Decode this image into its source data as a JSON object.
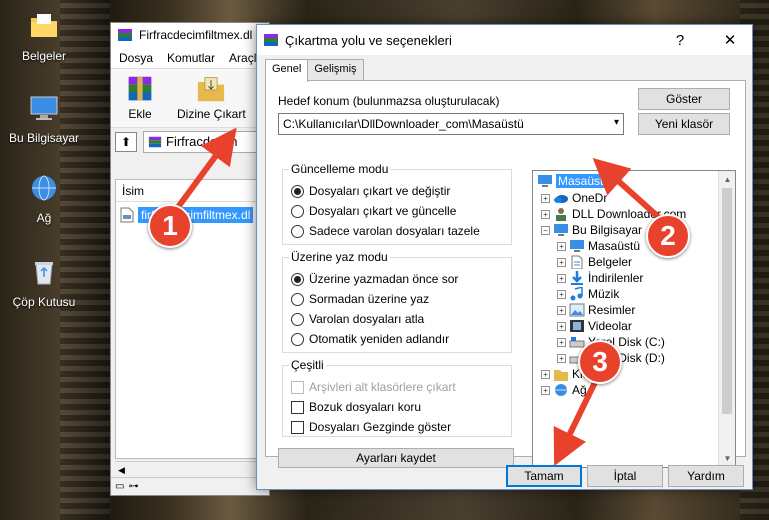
{
  "desktop": {
    "icons": [
      {
        "label": "Belgeler",
        "icon": "folder-icon"
      },
      {
        "label": "Bu Bilgisayar",
        "icon": "computer-icon"
      },
      {
        "label": "Ağ",
        "icon": "network-icon"
      },
      {
        "label": "Çöp Kutusu",
        "icon": "recycle-bin-icon"
      }
    ]
  },
  "winrar": {
    "title": "Firfracdecimfiltmex.dl",
    "menu": [
      "Dosya",
      "Komutlar",
      "Araçla"
    ],
    "toolbar": {
      "add_label": "Ekle",
      "extract_label": "Dizine Çıkart"
    },
    "path_text": "Firfracdecim",
    "column_name": "İsim",
    "file_name": "firfracdecimfiltmex.dl"
  },
  "dialog": {
    "title": "Çıkartma yolu ve seçenekleri",
    "help_btn": "?",
    "close_btn": "✕",
    "tabs": [
      "Genel",
      "Gelişmiş"
    ],
    "dest_label": "Hedef konum (bulunmazsa oluşturulacak)",
    "dest_value": "C:\\Kullanıcılar\\DllDownloader_com\\Masaüstü",
    "show_btn": "Göster",
    "new_folder_btn": "Yeni klasör",
    "update_mode": {
      "title": "Güncelleme modu",
      "options": [
        "Dosyaları çıkart ve değiştir",
        "Dosyaları çıkart ve güncelle",
        "Sadece varolan dosyaları tazele"
      ],
      "selected": 0
    },
    "overwrite_mode": {
      "title": "Üzerine yaz modu",
      "options": [
        "Üzerine yazmadan önce sor",
        "Sormadan üzerine yaz",
        "Varolan dosyaları atla",
        "Otomatik yeniden adlandır"
      ],
      "selected": 0
    },
    "misc": {
      "title": "Çeşitli",
      "options": [
        {
          "label": "Arşivleri alt klasörlere çıkart",
          "checked": false,
          "disabled": true
        },
        {
          "label": "Bozuk dosyaları koru",
          "checked": false,
          "disabled": false
        },
        {
          "label": "Dosyaları Gezginde göster",
          "checked": false,
          "disabled": false
        }
      ]
    },
    "save_settings_btn": "Ayarları kaydet",
    "tree": [
      {
        "label": "Masaüstü",
        "level": 0,
        "icon": "desktop-icon",
        "selected": true
      },
      {
        "label": "OneDr",
        "level": 1,
        "icon": "onedrive-icon"
      },
      {
        "label": "DLL Downloader.com",
        "level": 1,
        "icon": "user-icon"
      },
      {
        "label": "Bu Bilgisayar",
        "level": 1,
        "icon": "computer-icon",
        "expanded": true
      },
      {
        "label": "Masaüstü",
        "level": 2,
        "icon": "desktop-icon"
      },
      {
        "label": "Belgeler",
        "level": 2,
        "icon": "documents-icon"
      },
      {
        "label": "İndirilenler",
        "level": 2,
        "icon": "downloads-icon"
      },
      {
        "label": "Müzik",
        "level": 2,
        "icon": "music-icon"
      },
      {
        "label": "Resimler",
        "level": 2,
        "icon": "pictures-icon"
      },
      {
        "label": "Videolar",
        "level": 2,
        "icon": "videos-icon"
      },
      {
        "label": "Yerel Disk (C:)",
        "level": 2,
        "icon": "drive-icon"
      },
      {
        "label": "Yerel Disk (D:)",
        "level": 2,
        "icon": "drive-icon"
      },
      {
        "label": "Kita",
        "level": 1,
        "icon": "library-icon"
      },
      {
        "label": "Ağ",
        "level": 1,
        "icon": "network-icon"
      }
    ],
    "ok_btn": "Tamam",
    "cancel_btn": "İptal",
    "help_bottom_btn": "Yardım"
  },
  "callouts": [
    "1",
    "2",
    "3"
  ],
  "colors": {
    "callout": "#e8412c",
    "selection": "#3399ff",
    "accent_border": "#0078d7"
  }
}
